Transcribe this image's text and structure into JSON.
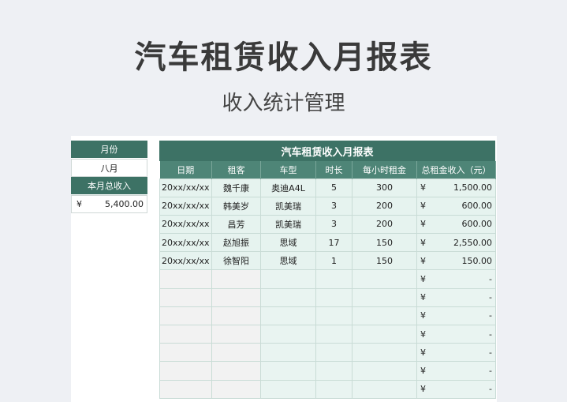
{
  "header": {
    "title": "汽车租赁收入月报表",
    "subtitle": "收入统计管理"
  },
  "summary": {
    "month_label": "月份",
    "month_value": "八月",
    "total_label": "本月总收入",
    "currency": "¥",
    "total_value": "5,400.00"
  },
  "table": {
    "title": "汽车租赁收入月报表",
    "columns": [
      "日期",
      "租客",
      "车型",
      "时长",
      "每小时租金",
      "总租金收入（元）"
    ],
    "rows": [
      {
        "date": "20xx/xx/xx",
        "tenant": "魏千康",
        "model": "奥迪A4L",
        "hours": "5",
        "rate": "300",
        "currency": "¥",
        "total": "1,500.00"
      },
      {
        "date": "20xx/xx/xx",
        "tenant": "韩美岁",
        "model": "凯美瑞",
        "hours": "3",
        "rate": "200",
        "currency": "¥",
        "total": "600.00"
      },
      {
        "date": "20xx/xx/xx",
        "tenant": "昌芳",
        "model": "凯美瑞",
        "hours": "3",
        "rate": "200",
        "currency": "¥",
        "total": "600.00"
      },
      {
        "date": "20xx/xx/xx",
        "tenant": "赵旭振",
        "model": "思域",
        "hours": "17",
        "rate": "150",
        "currency": "¥",
        "total": "2,550.00"
      },
      {
        "date": "20xx/xx/xx",
        "tenant": "徐智阳",
        "model": "思域",
        "hours": "1",
        "rate": "150",
        "currency": "¥",
        "total": "150.00"
      }
    ],
    "empty_rows": [
      {
        "currency": "¥",
        "total": "-"
      },
      {
        "currency": "¥",
        "total": "-"
      },
      {
        "currency": "¥",
        "total": "-"
      },
      {
        "currency": "¥",
        "total": "-"
      },
      {
        "currency": "¥",
        "total": "-"
      },
      {
        "currency": "¥",
        "total": "-"
      },
      {
        "currency": "¥",
        "total": "-"
      }
    ]
  },
  "colors": {
    "header_dark": "#3d7265",
    "header_mid": "#4e8577",
    "row_tint": "#e6f3ef"
  }
}
